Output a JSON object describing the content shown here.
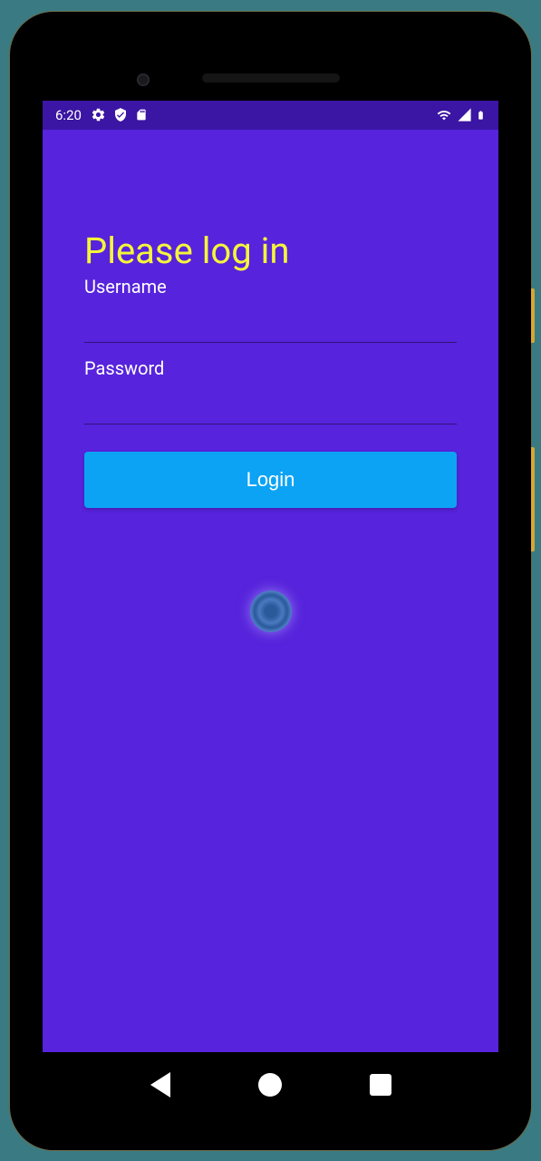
{
  "statusBar": {
    "time": "6:20"
  },
  "login": {
    "title": "Please log in",
    "usernameLabel": "Username",
    "usernameValue": "",
    "passwordLabel": "Password",
    "passwordValue": "",
    "buttonLabel": "Login"
  }
}
